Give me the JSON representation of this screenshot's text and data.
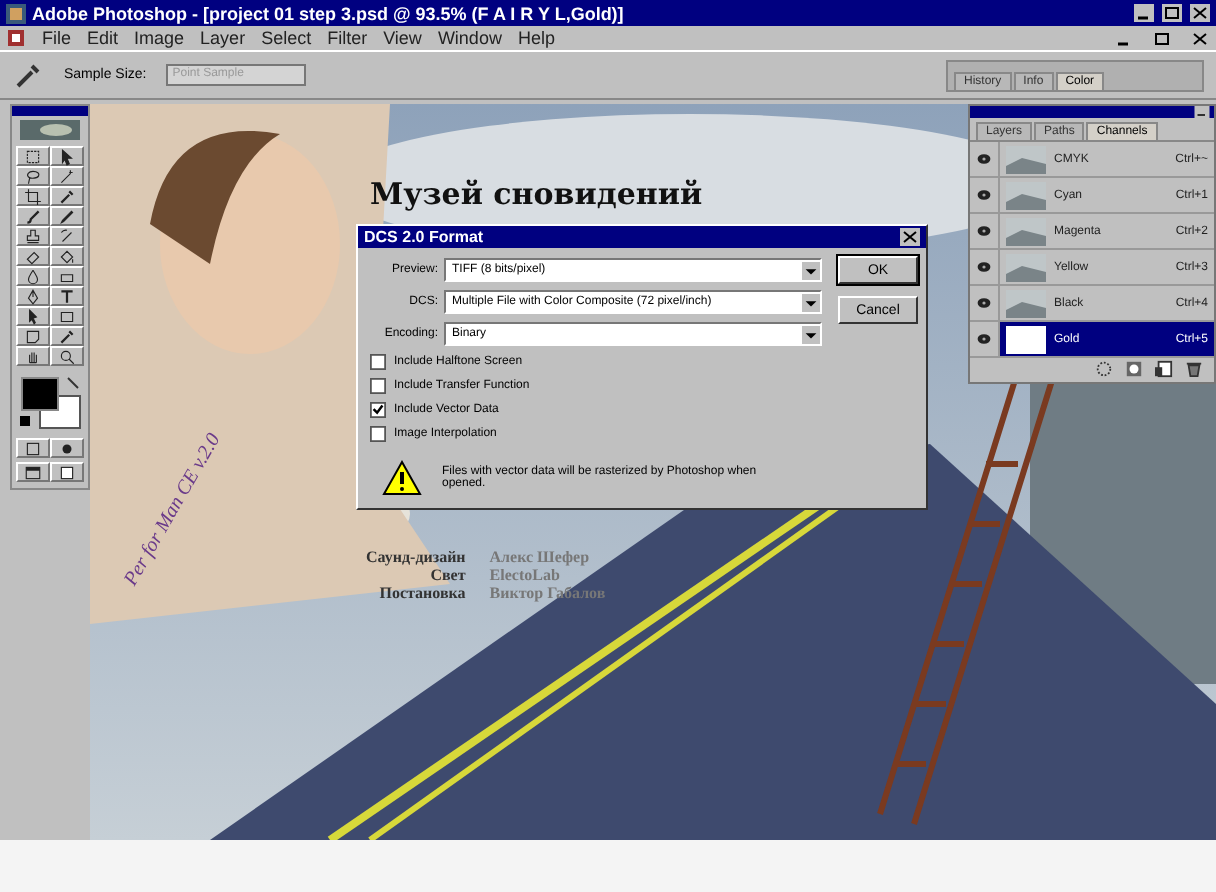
{
  "window": {
    "title": "Adobe Photoshop - [project 01 step 3.psd @ 93.5% (F A I R Y  L,Gold)]"
  },
  "menu": [
    "File",
    "Edit",
    "Image",
    "Layer",
    "Select",
    "Filter",
    "View",
    "Window",
    "Help"
  ],
  "options_bar": {
    "label": "Sample Size:",
    "value": "Point Sample",
    "disabled": true
  },
  "palette_tabs": [
    {
      "label": "History",
      "selected": false
    },
    {
      "label": "Info",
      "selected": false
    },
    {
      "label": "Color",
      "selected": true
    }
  ],
  "document": {
    "heading": "Музей сновидений",
    "arm_text": "Per for Man CE v.2.0",
    "credits": [
      {
        "role": "Саунд-дизайн",
        "name": "Алекс Шефер"
      },
      {
        "role": "Свет",
        "name": "ElectoLab"
      },
      {
        "role": "Постановка",
        "name": "Виктор Габалов"
      }
    ]
  },
  "dialog": {
    "title": "DCS 2.0 Format",
    "fields": [
      {
        "label": "Preview:",
        "value": "TIFF (8 bits/pixel)"
      },
      {
        "label": "DCS:",
        "value": "Multiple File with Color Composite (72 pixel/inch)"
      },
      {
        "label": "Encoding:",
        "value": "Binary"
      }
    ],
    "checkboxes": [
      {
        "label": "Include Halftone Screen",
        "checked": false
      },
      {
        "label": "Include Transfer Function",
        "checked": false
      },
      {
        "label": "Include Vector Data",
        "checked": true
      },
      {
        "label": "Image Interpolation",
        "checked": false
      }
    ],
    "message": "Files with vector data will be rasterized by Photoshop when opened.",
    "buttons": [
      "OK",
      "Cancel"
    ]
  },
  "channels_panel": {
    "tabs": [
      {
        "label": "Layers",
        "selected": false
      },
      {
        "label": "Paths",
        "selected": false
      },
      {
        "label": "Channels",
        "selected": true
      }
    ],
    "channels": [
      {
        "name": "CMYK",
        "shortcut": "Ctrl+~",
        "selected": false,
        "visible": true
      },
      {
        "name": "Cyan",
        "shortcut": "Ctrl+1",
        "selected": false,
        "visible": true
      },
      {
        "name": "Magenta",
        "shortcut": "Ctrl+2",
        "selected": false,
        "visible": true
      },
      {
        "name": "Yellow",
        "shortcut": "Ctrl+3",
        "selected": false,
        "visible": true
      },
      {
        "name": "Black",
        "shortcut": "Ctrl+4",
        "selected": false,
        "visible": true
      },
      {
        "name": "Gold",
        "shortcut": "Ctrl+5",
        "selected": true,
        "visible": true
      }
    ]
  }
}
